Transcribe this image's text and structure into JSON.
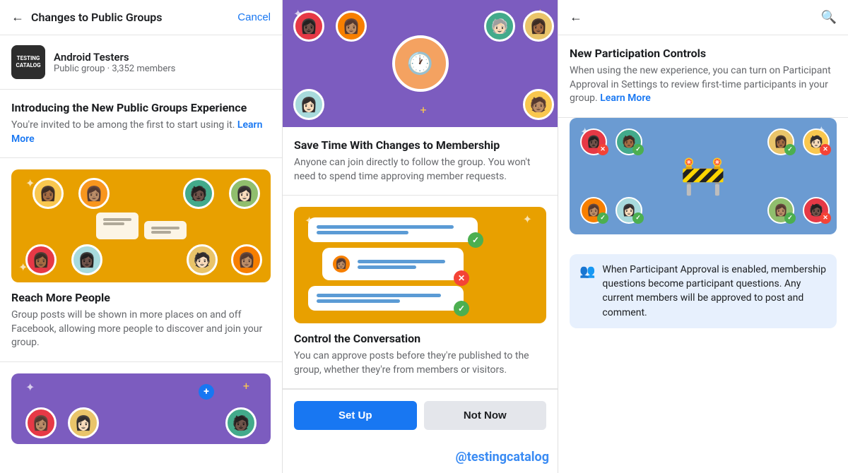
{
  "left_panel": {
    "header": {
      "back_label": "←",
      "title": "Changes to Public Groups",
      "cancel_label": "Cancel"
    },
    "group": {
      "name": "Android Testers",
      "sub": "Public group · 3,352 members",
      "avatar_line1": "TESTING",
      "avatar_line2": "CATALOG"
    },
    "intro": {
      "title": "Introducing the New Public Groups Experience",
      "desc": "You're invited to be among the first to start using it.",
      "learn_more": "Learn More"
    },
    "reach": {
      "title": "Reach More People",
      "desc": "Group posts will be shown in more places on and off Facebook, allowing more people to discover and join your group."
    }
  },
  "middle_panel": {
    "save_time": {
      "title": "Save Time With Changes to Membership",
      "desc": "Anyone can join directly to follow the group. You won't need to spend time approving member requests."
    },
    "control": {
      "title": "Control the Conversation",
      "desc": "You can approve posts before they're published to the group, whether they're from members or visitors."
    },
    "buttons": {
      "setup": "Set Up",
      "not_now": "Not Now"
    },
    "watermark": "@testingcatalog"
  },
  "right_panel": {
    "header": {
      "back_label": "←",
      "search_icon": "🔍"
    },
    "participation": {
      "title": "New Participation Controls",
      "desc": "When using the new experience, you can turn on Participant Approval in Settings to review first-time participants in your group.",
      "learn_more": "Learn More"
    },
    "info_box": {
      "text": "When Participant Approval is enabled, membership questions become participant questions. Any current members will be approved to post and comment."
    }
  }
}
